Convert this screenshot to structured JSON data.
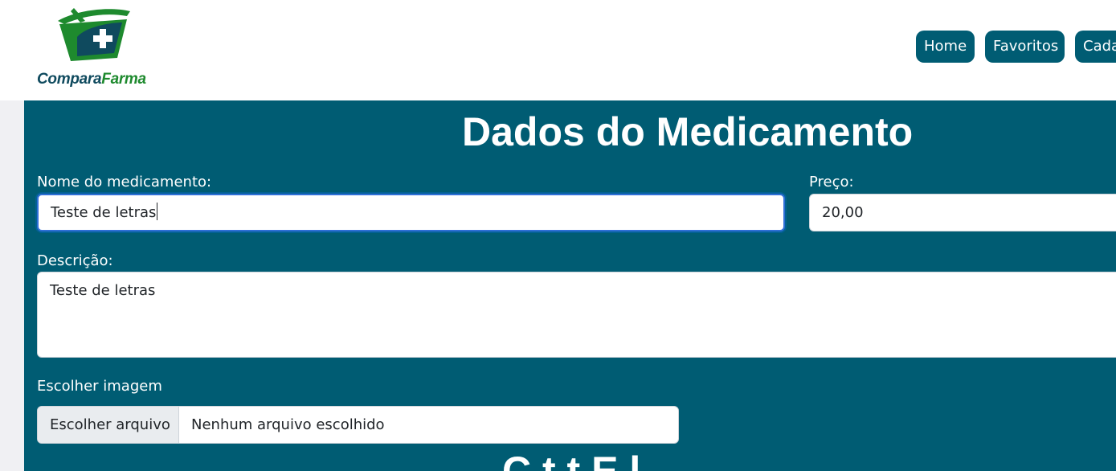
{
  "brand": {
    "name_part1": "Compara",
    "name_part2": "Farma",
    "colors": {
      "dark_teal": "#0f4a5e",
      "green": "#1e8a2e"
    }
  },
  "nav": {
    "items": [
      {
        "label": "Home"
      },
      {
        "label": "Favoritos"
      },
      {
        "label": "Cada"
      }
    ]
  },
  "form": {
    "title": "Dados do Medicamento",
    "name_label": "Nome do medicamento:",
    "name_value": "Teste de letras",
    "price_label": "Preço:",
    "price_value": "20,00",
    "description_label": "Descrição:",
    "description_value": "Teste de letras",
    "image_label": "Escolher imagem",
    "file_button_label": "Escolher arquivo",
    "file_status": "Nenhum arquivo escolhido"
  },
  "next_section": {
    "title_partial": "C    t t    E   l"
  },
  "colors": {
    "panel_bg": "#005c73",
    "nav_bg": "#005c73",
    "focus_border": "#2f6fd6"
  }
}
